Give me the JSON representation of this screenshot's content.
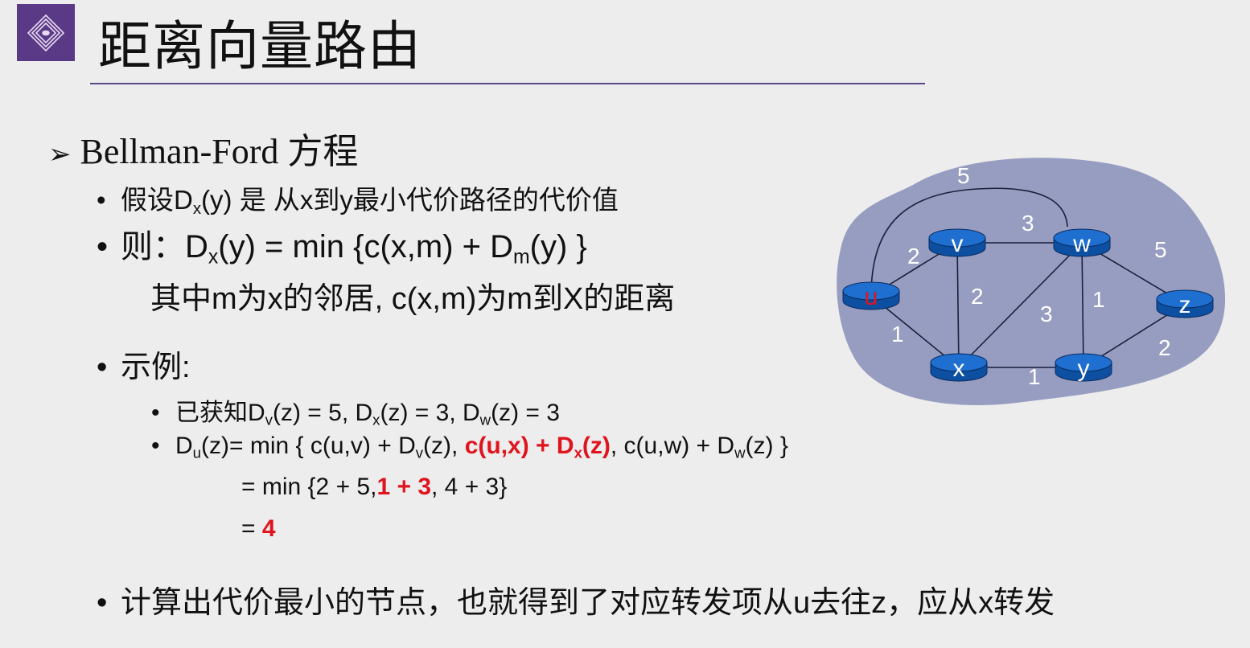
{
  "slide": {
    "title": "距离向量路由",
    "heading": {
      "marker": "➢",
      "text": "Bellman-Ford 方程"
    },
    "lines": [
      {
        "id": "assume",
        "bullet": "•",
        "segs": [
          {
            "t": "假设D"
          },
          {
            "t": "x",
            "sub": true
          },
          {
            "t": "(y) 是 从x到y最小代价路径的代价值"
          }
        ]
      },
      {
        "id": "then",
        "bullet": "•",
        "segs": [
          {
            "t": "则：D"
          },
          {
            "t": "x",
            "sub": true
          },
          {
            "t": "(y) = min {c(x,m) + D"
          },
          {
            "t": "m",
            "sub": true
          },
          {
            "t": "(y) }"
          }
        ]
      },
      {
        "id": "where",
        "bullet": "",
        "segs": [
          {
            "t": "其中m为x的邻居, c(x,m)为m到X的距离"
          }
        ]
      },
      {
        "id": "example",
        "bullet": "•",
        "segs": [
          {
            "t": "示例:"
          }
        ]
      },
      {
        "id": "known",
        "bullet": "•",
        "segs": [
          {
            "t": "已获知D"
          },
          {
            "t": "v",
            "sub": true
          },
          {
            "t": "(z) = 5, D"
          },
          {
            "t": "x",
            "sub": true
          },
          {
            "t": "(z) = 3, D"
          },
          {
            "t": "w",
            "sub": true
          },
          {
            "t": "(z) = 3"
          }
        ]
      },
      {
        "id": "du",
        "bullet": "•",
        "segs": [
          {
            "t": "D"
          },
          {
            "t": "u",
            "sub": true
          },
          {
            "t": "(z)= min { c(u,v) + D"
          },
          {
            "t": "v",
            "sub": true
          },
          {
            "t": "(z), "
          },
          {
            "t": "c(u,x) + D",
            "red": true
          },
          {
            "t": "x",
            "sub": true,
            "red": true
          },
          {
            "t": "(z)",
            "red": true
          },
          {
            "t": ", c(u,w) + D"
          },
          {
            "t": "w",
            "sub": true
          },
          {
            "t": "(z) }"
          }
        ]
      },
      {
        "id": "step1",
        "bullet": "",
        "segs": [
          {
            "t": "= min {2 + 5,"
          },
          {
            "t": "1 + 3",
            "red": true
          },
          {
            "t": ", 4 + 3}"
          }
        ]
      },
      {
        "id": "step2",
        "bullet": "",
        "segs": [
          {
            "t": "= "
          },
          {
            "t": "4",
            "red": true
          }
        ]
      },
      {
        "id": "conclusion",
        "bullet": "•",
        "segs": [
          {
            "t": "计算出代价最小的节点，也就得到了对应转发项从u去往z，应从x转发"
          }
        ]
      }
    ]
  },
  "graph": {
    "nodes": [
      {
        "id": "u",
        "label": "u",
        "red": true
      },
      {
        "id": "v",
        "label": "v"
      },
      {
        "id": "w",
        "label": "w"
      },
      {
        "id": "x",
        "label": "x"
      },
      {
        "id": "y",
        "label": "y"
      },
      {
        "id": "z",
        "label": "z"
      }
    ],
    "edges": [
      {
        "from": "u",
        "to": "w",
        "cost": "5"
      },
      {
        "from": "u",
        "to": "v",
        "cost": "2"
      },
      {
        "from": "u",
        "to": "x",
        "cost": "1"
      },
      {
        "from": "v",
        "to": "w",
        "cost": "3"
      },
      {
        "from": "v",
        "to": "x",
        "cost": "2"
      },
      {
        "from": "x",
        "to": "w",
        "cost": "3"
      },
      {
        "from": "w",
        "to": "y",
        "cost": "1"
      },
      {
        "from": "x",
        "to": "y",
        "cost": "1"
      },
      {
        "from": "w",
        "to": "z",
        "cost": "5"
      },
      {
        "from": "y",
        "to": "z",
        "cost": "2"
      }
    ]
  },
  "colors": {
    "accent": "#5a3a86",
    "highlight": "#e0141e",
    "cloud": "#959cc0",
    "router": "#1565c0"
  }
}
